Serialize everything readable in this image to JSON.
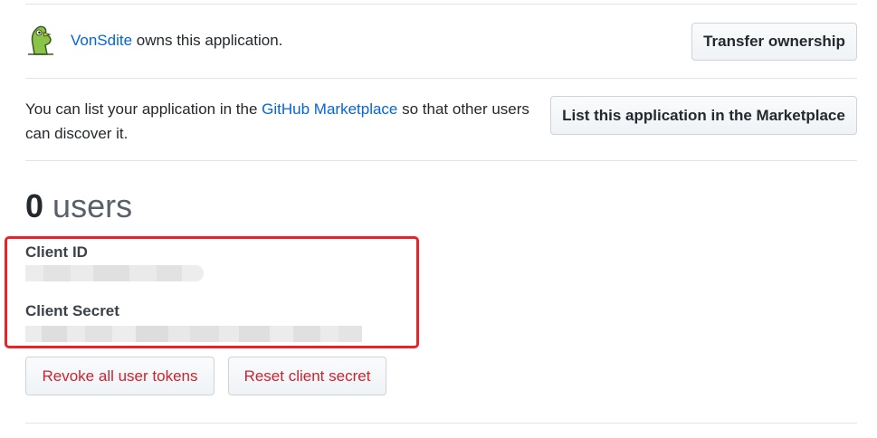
{
  "owner": {
    "username": "VonSdite",
    "suffix": " owns this application.",
    "transfer_label": "Transfer ownership"
  },
  "marketplace": {
    "text_before": "You can list your application in the ",
    "link_text": "GitHub Marketplace",
    "text_after": " so that other users can discover it.",
    "button_label": "List this application in the Marketplace"
  },
  "users": {
    "count": "0",
    "label": "users"
  },
  "client": {
    "id_label": "Client ID",
    "secret_label": "Client Secret"
  },
  "actions": {
    "revoke_label": "Revoke all user tokens",
    "reset_label": "Reset client secret"
  },
  "colors": {
    "link": "#0366d6",
    "danger": "#cb2431",
    "highlight": "#e8232a"
  },
  "icons": {
    "avatar": "green-cartoon-bird-avatar"
  }
}
